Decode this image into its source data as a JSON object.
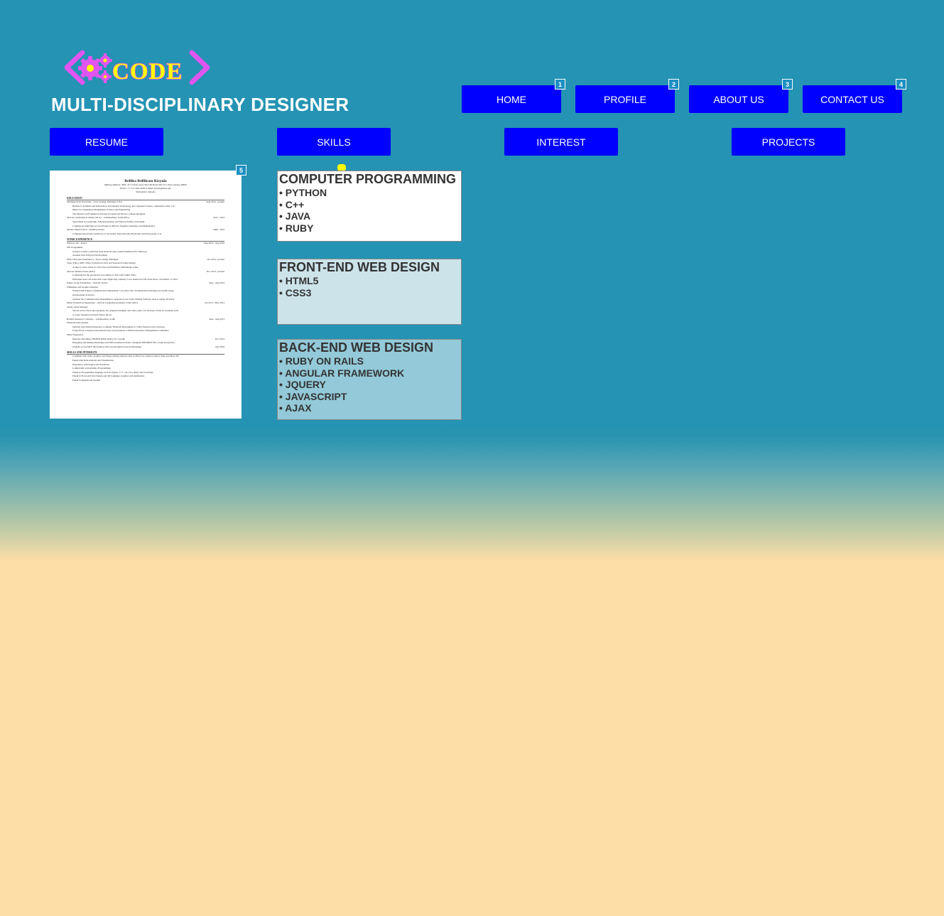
{
  "header": {
    "logo_text": "CODE",
    "tagline": "MULTI-DISCIPLINARY DESIGNER"
  },
  "colors": {
    "background_top": "#2593b3",
    "background_bottom": "#fddea6",
    "button": "#0000ff",
    "logo_pink": "#e055f0",
    "logo_yellow": "#ffff00"
  },
  "nav": {
    "items": [
      {
        "label": "HOME",
        "badge": "1"
      },
      {
        "label": "PROFILE",
        "badge": "2"
      },
      {
        "label": "ABOUT US",
        "badge": "3"
      },
      {
        "label": "CONTACT US",
        "badge": "4"
      }
    ]
  },
  "sections": {
    "items": [
      {
        "label": "RESUME"
      },
      {
        "label": "SKILLS"
      },
      {
        "label": "INTEREST"
      },
      {
        "label": "PROJECTS"
      }
    ]
  },
  "resume": {
    "badge": "5",
    "name": "Rellika Rellikson Kisyula",
    "contact": [
      "Mailing Address: MSU 417 S Shaw Lane West McDonel Rm 515, East Lansing 48825",
      "Phone: +1 517-940-2328, E-Mail: kisyula@msu.edu",
      "Nationality: Kenyan"
    ],
    "education_heading": "EDUCATION",
    "education": [
      {
        "text": "Michigan State University – East Lansing, Michigan, USA",
        "date": "Sept 2014 - present",
        "bullet": false
      },
      {
        "text": "Bachelor's in Media and Information, Information Technology and Computer Science. Cumulative GPA: 3.47",
        "date": "",
        "bullet": true
      },
      {
        "text": "Minor in Computation Mathematics Science and Engineering",
        "date": "",
        "bullet": true
      },
      {
        "text": "The MasterCard Foundation Scholars Program and Honors College Recipient",
        "date": "",
        "bullet": true
      },
      {
        "text": "African Leadership Academy (ALA) – Johannesburg, South Africa",
        "date": "2012 - 2014",
        "bullet": false
      },
      {
        "text": "Specialized in Leadership, Entrepreneurship, and African Studies curriculum",
        "date": "",
        "bullet": true
      },
      {
        "text": "Completed Cambridge A-Level Exams in Physics, English, Chemistry and Mathematics",
        "date": "",
        "bullet": true
      },
      {
        "text": "Alliance High School – Kiambu, Kenya",
        "date": "2009 - 2012",
        "bullet": false
      },
      {
        "text": "Completed the Kenya Certificate of Secondary Education (KCSE) Exam with mean grade of A.",
        "date": "",
        "bullet": true
      }
    ],
    "work_heading": "WORK EXPERIENCE",
    "work": [
      {
        "text": "mSurvey Inc.- Kenya",
        "date": "June 2016 - Aug 2016",
        "bullet": false
      },
      {
        "text": "API Programmer",
        "date": "",
        "bullet": false
      },
      {
        "text": "Worked on API to pull data from Keen IO and to make Dashboard for mSurvey",
        "date": "",
        "bullet": true
      },
      {
        "text": "Assisted with Software Development",
        "date": "",
        "bullet": true
      },
      {
        "text": "MSU Telecaster (SideShow) – East Lansing, Michigan",
        "date": "Oct 2014 - present",
        "bullet": false
      },
      {
        "text": "Video Editor, MSU Video Production Clubs and Spartasoft Game Design",
        "date": "",
        "bullet": false
      },
      {
        "text": "Acting as video-editor for both Turn and SideShow Multimedia Clubs.",
        "date": "",
        "bullet": true
      },
      {
        "text": "African Student Union (ASU)",
        "date": "Nov 2014 - present",
        "bullet": false
      },
      {
        "text": "Contributed in the production and editing of ASU Gala Night Video",
        "date": "",
        "bullet": true
      },
      {
        "text": "Performed lead role in the ASU Gala Night Play whereby I was featured in The State News- November 15 2014",
        "date": "",
        "bullet": true
      },
      {
        "text": "Equity Group Foundation – Nairobi, Kenya",
        "date": "June - Aug 2014",
        "bullet": false
      },
      {
        "text": "Filmmaker and Graphic Designer",
        "date": "",
        "bullet": false
      },
      {
        "text": "Worked with Equity Communication Department to produce four documentaries featuring successful young",
        "date": "",
        "bullet": true
      },
      {
        "text": "entrepreneurs in Kenya.",
        "date": "",
        "bullet": true
      },
      {
        "text": "Assisted the Communication Department to upgrade to new Video Editing Software such as Adobe Products.",
        "date": "",
        "bullet": true
      },
      {
        "text": "Music Production Department – African Leadership Academy, South Africa",
        "date": "Jan 2013 - May 2014",
        "bullet": false
      },
      {
        "text": "Audio-visual Manager",
        "date": "",
        "bullet": false
      },
      {
        "text": "Served as the school photographer, DJ, graphical designer and video-editor for all major events in Academy such",
        "date": "",
        "bullet": true
      },
      {
        "text": "as Guest Speakers and Inter House Sports",
        "date": "",
        "bullet": true
      },
      {
        "text": "Hollard Insurance Company – Johannesburg, South",
        "date": "June - Aug 2013",
        "bullet": false
      },
      {
        "text": "Financial Data Analyst",
        "date": "",
        "bullet": false
      },
      {
        "text": "Interned with Hollard Insurance Company Financial Department to collect financial data in Kenya.",
        "date": "",
        "bullet": true
      },
      {
        "text": "Using Excel, I analyzed the financial data and presented to Hollard Insurance Management Committee.",
        "date": "",
        "bullet": true
      },
      {
        "text": "Other Experience",
        "date": "",
        "bullet": false
      },
      {
        "text": "Interned with Impact 88.9FM (MSU Radio) for a month",
        "date": "Nov 2014",
        "bullet": true
      },
      {
        "text": "Designing and making Messenger and SMS automated Chabot. Designed INFOMGF Bot to help prospective",
        "date": "",
        "bullet": true
      },
      {
        "text": "students access MCF Information with ease through Facebook Messenger",
        "date": "July 2016",
        "bullet": true
      }
    ],
    "skills_heading": "SKILLS AND INTERESTS",
    "skills": [
      "Confident with video, graphics and image editing software such as Final Cut, Adobe Creative Suite and Maya 3D",
      "Fluent with Data Analysis and Visualization",
      "Experience with Drupal and WordPress",
      "Comfortable with Arduino Programming",
      "Fluent in Programming language such as Python, C++, C#, Java, Ruby and JavaScript",
      "Fluent in Front-end Web Design and 3D Computer Graphics and Animations",
      "Fluent in English and Swahili"
    ]
  },
  "skills": [
    {
      "title": "COMPUTER PROGRAMMING",
      "items": [
        "• PYTHON",
        "• C++",
        "• JAVA",
        "• RUBY"
      ],
      "bg": "#ffffff"
    },
    {
      "title": "FRONT-END WEB DESIGN",
      "items": [
        "• HTML5",
        "• CSS3"
      ],
      "bg": "#cce3ea"
    },
    {
      "title": "BACK-END WEB DESIGN",
      "items": [
        "• RUBY ON RAILS",
        "• ANGULAR FRAMEWORK",
        "• JQUERY",
        "• JAVASCRIPT",
        "• AJAX"
      ],
      "bg": "#93c9d8"
    }
  ]
}
